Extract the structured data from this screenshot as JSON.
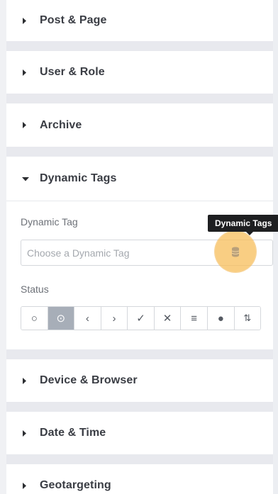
{
  "sections_top": [
    {
      "label": "Post & Page",
      "expanded": false
    },
    {
      "label": "User & Role",
      "expanded": false
    },
    {
      "label": "Archive",
      "expanded": false
    },
    {
      "label": "Dynamic Tags",
      "expanded": true
    }
  ],
  "dynamic_tags": {
    "field_label": "Dynamic Tag",
    "select_placeholder": "Choose a Dynamic Tag",
    "tooltip": "Dynamic Tags",
    "status_label": "Status",
    "status_options": [
      {
        "icon": "circle-outline-icon",
        "glyph": "○",
        "active": false
      },
      {
        "icon": "circle-dot-icon",
        "glyph": "⊙",
        "active": true
      },
      {
        "icon": "chevron-left-icon",
        "glyph": "‹",
        "active": false
      },
      {
        "icon": "chevron-right-icon",
        "glyph": "›",
        "active": false
      },
      {
        "icon": "check-icon",
        "glyph": "✓",
        "active": false
      },
      {
        "icon": "close-icon",
        "glyph": "✕",
        "active": false
      },
      {
        "icon": "menu-lines-icon",
        "glyph": "≡",
        "active": false
      },
      {
        "icon": "filled-circle-icon",
        "glyph": "●",
        "active": false
      },
      {
        "icon": "sort-arrows-icon",
        "glyph": "⇅",
        "active": false
      }
    ]
  },
  "sections_bottom": [
    {
      "label": "Device & Browser",
      "expanded": false
    },
    {
      "label": "Date & Time",
      "expanded": false
    },
    {
      "label": "Geotargeting",
      "expanded": false
    }
  ],
  "colors": {
    "accent_highlight": "#f7be5a",
    "tooltip_bg": "#1e1f21",
    "active_status": "#a7aeb8",
    "gap": "#e8e9ee"
  }
}
